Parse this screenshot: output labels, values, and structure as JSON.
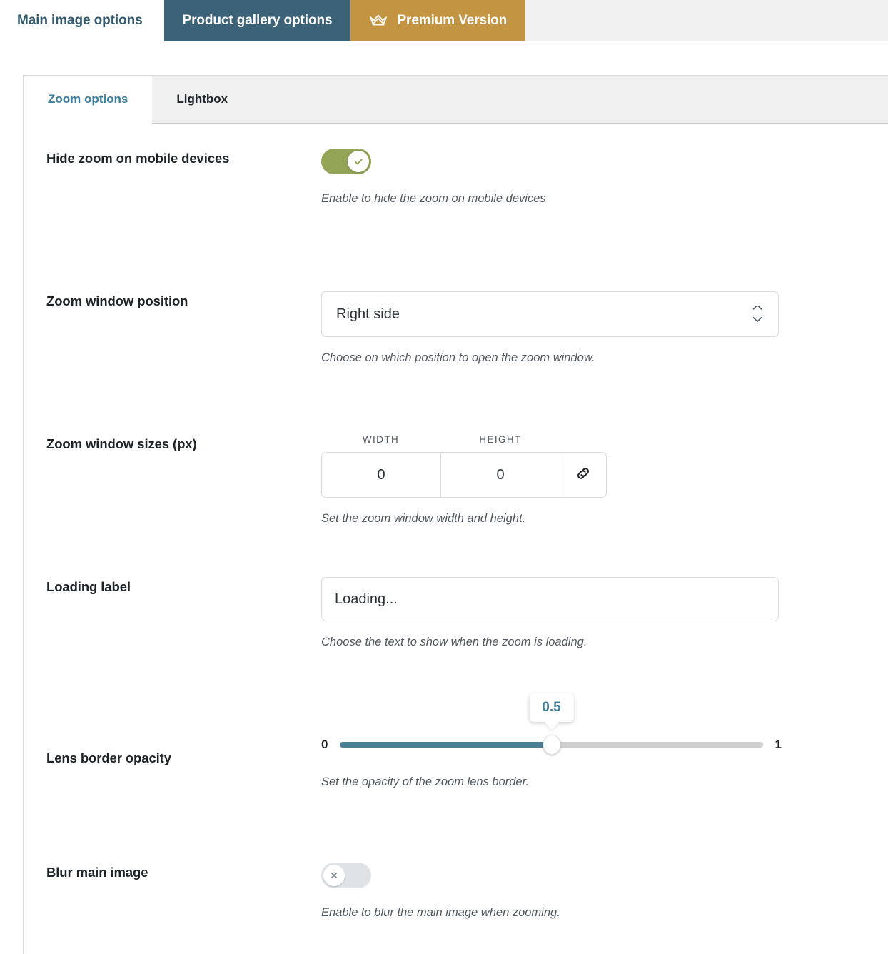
{
  "outer_tabs": [
    {
      "label": "Main image options",
      "state": "inactive-light"
    },
    {
      "label": "Product gallery options",
      "state": "active-dark"
    },
    {
      "label": "Premium Version",
      "state": "premium",
      "icon": "crown-icon"
    }
  ],
  "inner_tabs": [
    {
      "label": "Zoom options",
      "active": true
    },
    {
      "label": "Lightbox",
      "active": false
    }
  ],
  "colors": {
    "gallery_tab_bg": "#3c6278",
    "premium_tab_bg": "#c39543",
    "active_tab_text": "#3a7d9c",
    "toggle_on": "#93a456",
    "toggle_off": "#dfe3e8",
    "slider_fill": "#4c7f97",
    "slider_track": "#cfcfcf",
    "page_chrome": "#f0f0f1",
    "label_text": "#1d2327",
    "help_text": "#50575e"
  },
  "settings": [
    {
      "label": "Hide zoom on mobile devices",
      "control": "toggle",
      "value": "on",
      "icon": "check-icon",
      "help": "Enable to hide the zoom on mobile devices"
    },
    {
      "label": "Zoom window position",
      "control": "select",
      "value": "Right side",
      "icon": "chevron-updown-icon",
      "help": "Choose on which position to open the zoom window."
    },
    {
      "label": "Zoom window sizes (px)",
      "control": "size-pair",
      "width_header": "WIDTH",
      "height_header": "HEIGHT",
      "width_value": "0",
      "height_value": "0",
      "icon": "link-icon",
      "help": "Set the zoom window width and height."
    },
    {
      "label": "Loading label",
      "control": "text",
      "value": "Loading...",
      "placeholder": "Loading...",
      "help": "Choose the text to show when the zoom is loading."
    },
    {
      "label": "Lens border opacity",
      "control": "slider",
      "value": "0.5",
      "min": "0",
      "max": "1",
      "fill_percent": 50,
      "help": "Set the opacity of the zoom lens border."
    },
    {
      "label": "Blur main image",
      "control": "toggle",
      "value": "off",
      "icon": "close-icon",
      "help": "Enable to blur the main image when zooming."
    }
  ]
}
